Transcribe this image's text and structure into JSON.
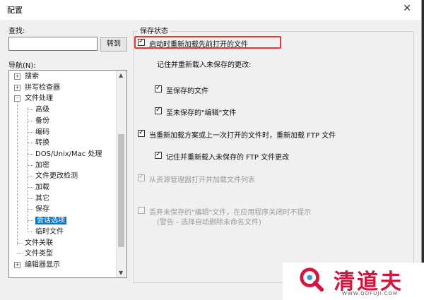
{
  "window": {
    "title": "配置",
    "close_icon": "✕"
  },
  "search": {
    "label": "查找:",
    "value": "",
    "button": "转到"
  },
  "nav": {
    "label": "导航(N):",
    "items": [
      {
        "label": "搜索",
        "level": 0,
        "expander": "+"
      },
      {
        "label": "拼写检查器",
        "level": 0,
        "expander": "+"
      },
      {
        "label": "文件处理",
        "level": 0,
        "expander": "-"
      },
      {
        "label": "高级",
        "level": 1
      },
      {
        "label": "备份",
        "level": 1
      },
      {
        "label": "编码",
        "level": 1
      },
      {
        "label": "转换",
        "level": 1
      },
      {
        "label": "DOS/Unix/Mac 处理",
        "level": 1
      },
      {
        "label": "加密",
        "level": 1
      },
      {
        "label": "文件更改检测",
        "level": 1
      },
      {
        "label": "加载",
        "level": 1
      },
      {
        "label": "其它",
        "level": 1
      },
      {
        "label": "保存",
        "level": 1
      },
      {
        "label": "会话选项",
        "level": 1,
        "selected": true
      },
      {
        "label": "临时文件",
        "level": 1
      },
      {
        "label": "文件关联",
        "level": 0
      },
      {
        "label": "文件类型",
        "level": 0
      },
      {
        "label": "编辑器显示",
        "level": 0,
        "expander": "+"
      }
    ]
  },
  "group": {
    "title": "保存状态",
    "opt_reload": "启动时重新加载先前打开的文件",
    "remember_label": "记住并重新载入未保存的更改:",
    "opt_saved": "至保存的文件",
    "opt_unsaved": "至未保存的\"编辑\"文件",
    "opt_ftp": "当重新加载方案或上一次打开的文件时，重新加载 FTP 文件",
    "opt_ftp_remember": "记住并重新载入未保存的 FTP 文件更改",
    "opt_explorer": "从资源管理器打开并加载文件列表",
    "opt_discard": "丢弃未保存的\"编辑\"文件，在应用程序关闭时不提示",
    "opt_discard_note": "(警告 - 选择自动删除未命名文件)"
  },
  "watermark": {
    "text": "清道夫",
    "url": "WWW.QDFUJI.COM"
  }
}
